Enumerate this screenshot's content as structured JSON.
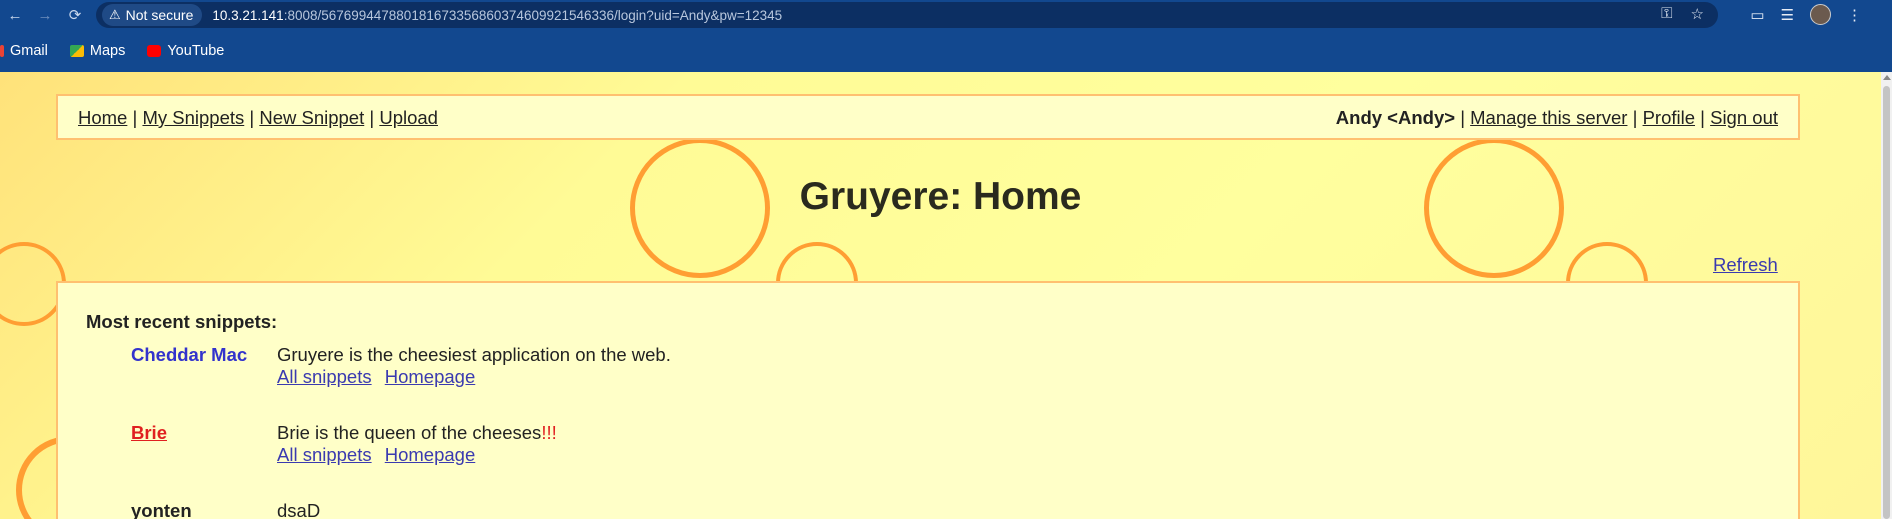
{
  "browser": {
    "security_label": "Not secure",
    "url_host": "10.3.21.141",
    "url_rest": ":8008/567699447880181673356860374609921546336/login?uid=Andy&pw=12345",
    "bookmarks": [
      "Gmail",
      "Maps",
      "YouTube"
    ]
  },
  "menu": {
    "home": "Home",
    "my_snippets": "My Snippets",
    "new_snippet": "New Snippet",
    "upload": "Upload",
    "user": "Andy <Andy>",
    "manage": "Manage this server",
    "profile": "Profile",
    "sign_out": "Sign out",
    "separator": "|"
  },
  "page": {
    "title": "Gruyere: Home",
    "refresh": "Refresh",
    "recent_heading": "Most recent snippets:"
  },
  "snippets": [
    {
      "author": "Cheddar Mac",
      "text": "Gruyere is the cheesiest application on the web.",
      "links": [
        "All snippets",
        "Homepage"
      ]
    },
    {
      "author": "Brie",
      "text": "Brie is the queen of the cheeses",
      "emphasis": "!!!",
      "links": [
        "All snippets",
        "Homepage"
      ]
    },
    {
      "author": "yonten",
      "text": "dsaD"
    }
  ],
  "colors": {
    "chrome": "#12488f",
    "page_bg": "#ffff9e",
    "panel_bg": "#ffffc8",
    "panel_border": "#ffc070",
    "bubble": "#ff9e33",
    "link": "#3a3ab0",
    "brie": "#e02020",
    "cheddar": "#3333cc"
  }
}
